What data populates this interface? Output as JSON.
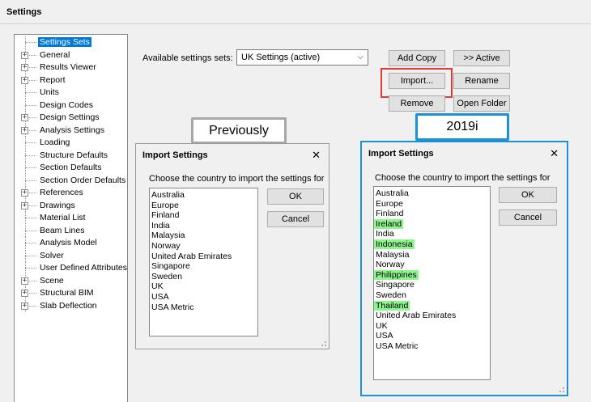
{
  "window": {
    "title": "Settings"
  },
  "tree": [
    {
      "label": "Settings Sets",
      "expandable": false,
      "selected": true
    },
    {
      "label": "General",
      "expandable": true
    },
    {
      "label": "Results Viewer",
      "expandable": true
    },
    {
      "label": "Report",
      "expandable": true
    },
    {
      "label": "Units",
      "expandable": false
    },
    {
      "label": "Design Codes",
      "expandable": false
    },
    {
      "label": "Design Settings",
      "expandable": true
    },
    {
      "label": "Analysis Settings",
      "expandable": true
    },
    {
      "label": "Loading",
      "expandable": false
    },
    {
      "label": "Structure Defaults",
      "expandable": false
    },
    {
      "label": "Section Defaults",
      "expandable": false
    },
    {
      "label": "Section Order Defaults",
      "expandable": false
    },
    {
      "label": "References",
      "expandable": true
    },
    {
      "label": "Drawings",
      "expandable": true
    },
    {
      "label": "Material List",
      "expandable": false
    },
    {
      "label": "Beam Lines",
      "expandable": false
    },
    {
      "label": "Analysis Model",
      "expandable": false
    },
    {
      "label": "Solver",
      "expandable": false
    },
    {
      "label": "User Defined Attributes",
      "expandable": false
    },
    {
      "label": "Scene",
      "expandable": true
    },
    {
      "label": "Structural BIM",
      "expandable": true
    },
    {
      "label": "Slab Deflection",
      "expandable": true
    }
  ],
  "settings_sets": {
    "label": "Available settings sets:",
    "selected": "UK Settings (active)",
    "buttons": {
      "add_copy": "Add Copy",
      "active": ">> Active",
      "import": "Import...",
      "rename": "Rename",
      "remove": "Remove",
      "open_folder": "Open Folder"
    }
  },
  "captions": {
    "previously": "Previously",
    "new_version": "2019i"
  },
  "dialog_prev": {
    "title": "Import Settings",
    "close": "✕",
    "prompt": "Choose the country to import the settings for",
    "ok": "OK",
    "cancel": "Cancel",
    "countries": [
      {
        "name": "Australia"
      },
      {
        "name": "Europe"
      },
      {
        "name": "Finland"
      },
      {
        "name": "India"
      },
      {
        "name": "Malaysia"
      },
      {
        "name": "Norway"
      },
      {
        "name": "United Arab Emirates"
      },
      {
        "name": "Singapore"
      },
      {
        "name": "Sweden"
      },
      {
        "name": "UK"
      },
      {
        "name": "USA"
      },
      {
        "name": "USA Metric"
      }
    ]
  },
  "dialog_new": {
    "title": "Import Settings",
    "close": "✕",
    "prompt": "Choose the country to import the settings for",
    "ok": "OK",
    "cancel": "Cancel",
    "countries": [
      {
        "name": "Australia"
      },
      {
        "name": "Europe"
      },
      {
        "name": "Finland"
      },
      {
        "name": "Ireland",
        "highlight": true
      },
      {
        "name": "India"
      },
      {
        "name": "Indonesia",
        "highlight": true
      },
      {
        "name": "Malaysia"
      },
      {
        "name": "Norway"
      },
      {
        "name": "Philippines",
        "highlight": true
      },
      {
        "name": "Singapore"
      },
      {
        "name": "Sweden"
      },
      {
        "name": "Thailand",
        "highlight": true
      },
      {
        "name": "United Arab Emirates"
      },
      {
        "name": "UK"
      },
      {
        "name": "USA"
      },
      {
        "name": "USA Metric"
      }
    ]
  },
  "colors": {
    "highlight": "#8ef58e",
    "accent_blue": "#1e90d6",
    "import_outline": "#e53935",
    "selection": "#0078d7"
  }
}
